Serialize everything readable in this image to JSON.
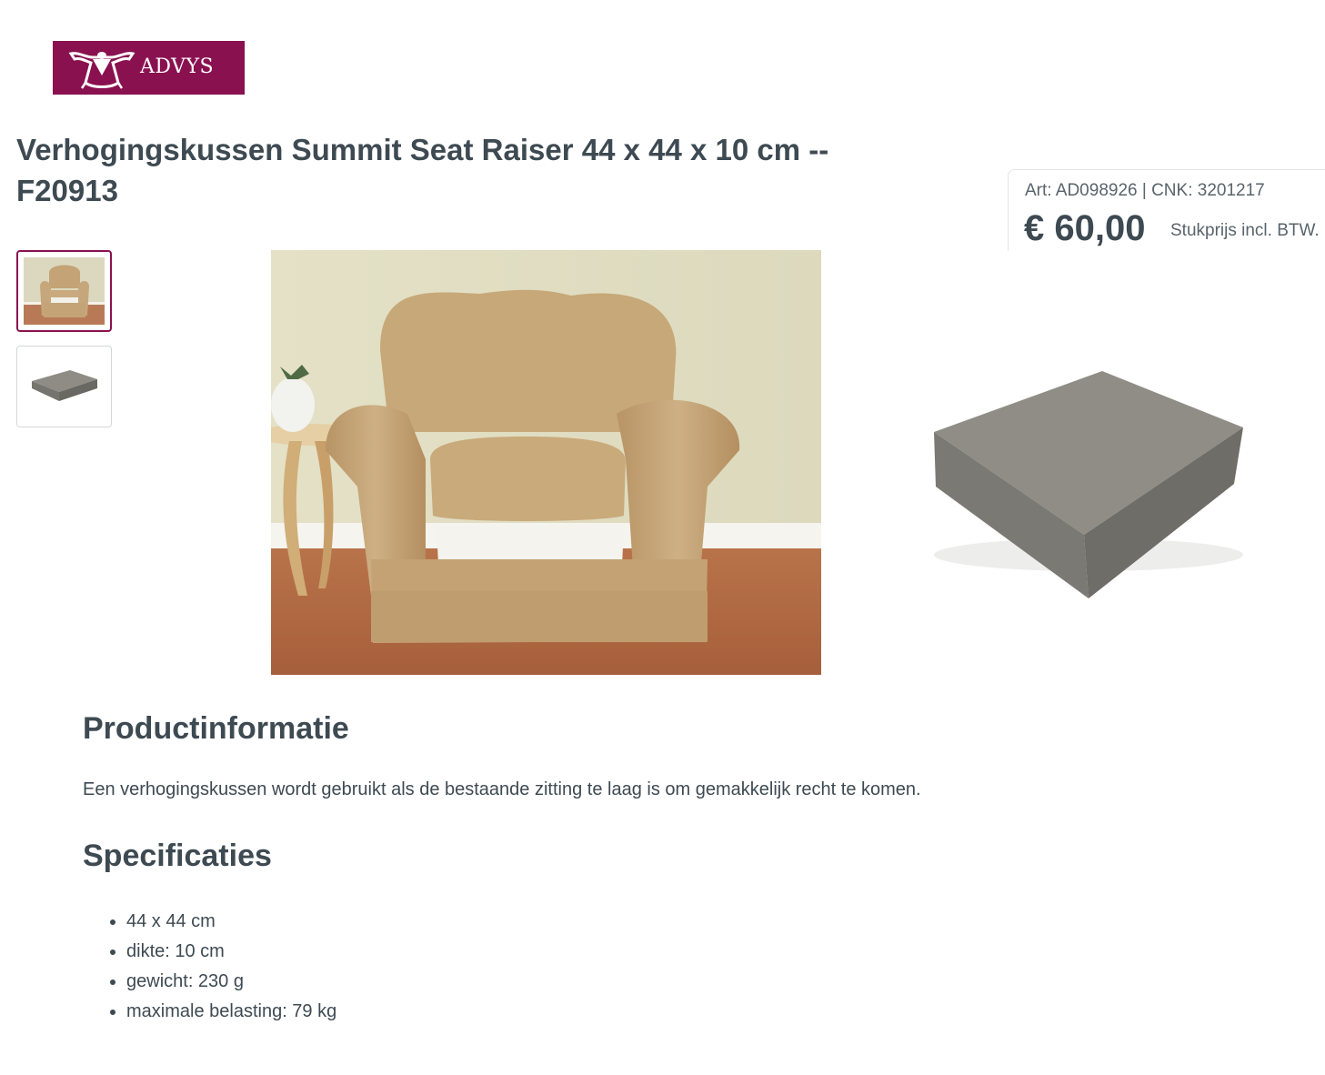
{
  "header": {
    "logo_text": "ADVYS",
    "logo_color": "#8a1150",
    "logo_icon": "advys-emblem-icon"
  },
  "product": {
    "title": "Verhogingskussen Summit Seat Raiser 44 x 44 x 10 cm -- F20913",
    "art_line": "Art: AD098926 | CNK: 3201217",
    "price": "€ 60,00",
    "price_note": "Stukprijs incl. BTW."
  },
  "gallery": {
    "thumbnails": [
      {
        "icon": "armchair-photo",
        "selected": true
      },
      {
        "icon": "foam-cushion-photo",
        "selected": false
      }
    ],
    "main_image": "armchair-photo",
    "side_image": "foam-cushion-photo"
  },
  "info": {
    "heading": "Productinformatie",
    "description": "Een verhogingskussen wordt gebruikt als de bestaande zitting te laag is om gemakkelijk recht te komen."
  },
  "specs": {
    "heading": "Specificaties",
    "items": [
      "44 x 44 cm",
      "dikte: 10 cm",
      "gewicht: 230 g",
      "maximale belasting: 79 kg"
    ]
  }
}
